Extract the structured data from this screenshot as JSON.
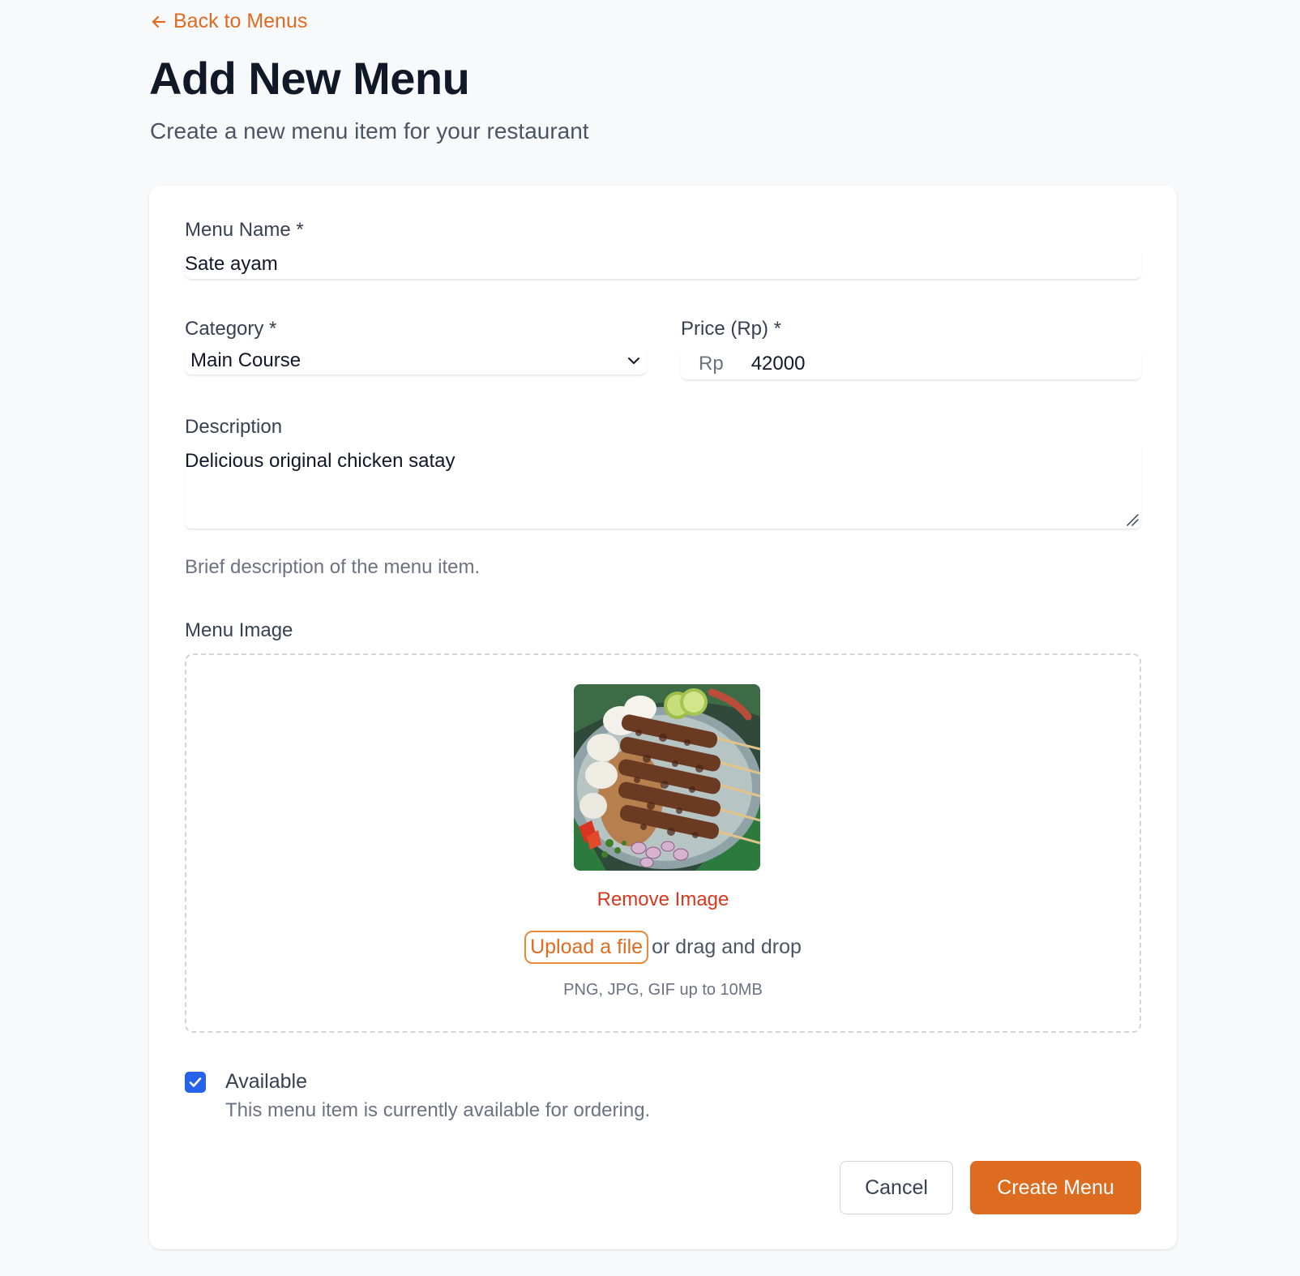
{
  "nav": {
    "back_label": "Back to Menus"
  },
  "header": {
    "title": "Add New Menu",
    "subtitle": "Create a new menu item for your restaurant"
  },
  "form": {
    "name": {
      "label": "Menu Name *",
      "value": "Sate ayam"
    },
    "category": {
      "label": "Category *",
      "value": "Main Course"
    },
    "price": {
      "label": "Price (Rp) *",
      "prefix": "Rp",
      "value": "42000"
    },
    "description": {
      "label": "Description",
      "value": "Delicious original chicken satay",
      "help": "Brief description of the menu item."
    },
    "image": {
      "label": "Menu Image",
      "remove_label": "Remove Image",
      "upload_label": "Upload a file",
      "drag_text": "or drag and drop",
      "hint": "PNG, JPG, GIF up to 10MB"
    },
    "available": {
      "checked": true,
      "label": "Available",
      "help": "This menu item is currently available for ordering."
    }
  },
  "actions": {
    "cancel_label": "Cancel",
    "create_label": "Create Menu"
  },
  "colors": {
    "accent": "#dd6b20",
    "danger": "#d9381e",
    "checkbox": "#2563eb",
    "background": "#f8f9fb"
  }
}
